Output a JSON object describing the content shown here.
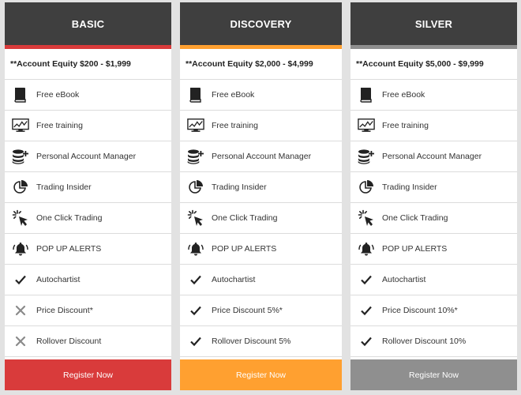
{
  "plans": [
    {
      "name": "BASIC",
      "accent": "#d93b3b",
      "equity": "**Account Equity $200 - $1,999",
      "features": [
        {
          "icon": "book-icon",
          "label": "Free eBook"
        },
        {
          "icon": "monitor-chart-icon",
          "label": "Free training"
        },
        {
          "icon": "coins-plus-icon",
          "label": "Personal Account Manager"
        },
        {
          "icon": "pie-chart-icon",
          "label": "Trading Insider"
        },
        {
          "icon": "cursor-click-icon",
          "label": "One Click Trading"
        },
        {
          "icon": "bell-icon",
          "label": "POP UP ALERTS"
        },
        {
          "icon": "check-icon",
          "label": "Autochartist"
        },
        {
          "icon": "cross-icon",
          "label": "Price Discount*"
        },
        {
          "icon": "cross-icon",
          "label": "Rollover Discount"
        }
      ],
      "button": "Register Now"
    },
    {
      "name": "DISCOVERY",
      "accent": "#ffa030",
      "equity": "**Account Equity $2,000 - $4,999",
      "features": [
        {
          "icon": "book-icon",
          "label": "Free eBook"
        },
        {
          "icon": "monitor-chart-icon",
          "label": "Free training"
        },
        {
          "icon": "coins-plus-icon",
          "label": "Personal Account Manager"
        },
        {
          "icon": "pie-chart-icon",
          "label": "Trading Insider"
        },
        {
          "icon": "cursor-click-icon",
          "label": "One Click Trading"
        },
        {
          "icon": "bell-icon",
          "label": "POP UP ALERTS"
        },
        {
          "icon": "check-icon",
          "label": "Autochartist"
        },
        {
          "icon": "check-icon",
          "label": "Price Discount 5%*"
        },
        {
          "icon": "check-icon",
          "label": "Rollover Discount 5%"
        }
      ],
      "button": "Register Now"
    },
    {
      "name": "SILVER",
      "accent": "#8f8f8f",
      "equity": "**Account Equity $5,000 - $9,999",
      "features": [
        {
          "icon": "book-icon",
          "label": "Free eBook"
        },
        {
          "icon": "monitor-chart-icon",
          "label": "Free training"
        },
        {
          "icon": "coins-plus-icon",
          "label": "Personal Account Manager"
        },
        {
          "icon": "pie-chart-icon",
          "label": "Trading Insider"
        },
        {
          "icon": "cursor-click-icon",
          "label": "One Click Trading"
        },
        {
          "icon": "bell-icon",
          "label": "POP UP ALERTS"
        },
        {
          "icon": "check-icon",
          "label": "Autochartist"
        },
        {
          "icon": "check-icon",
          "label": "Price Discount 10%*"
        },
        {
          "icon": "check-icon",
          "label": "Rollover Discount 10%"
        }
      ],
      "button": "Register Now"
    }
  ],
  "colors": {
    "header_bg": "#3f3f3f",
    "page_bg": "#e2e2e2"
  }
}
